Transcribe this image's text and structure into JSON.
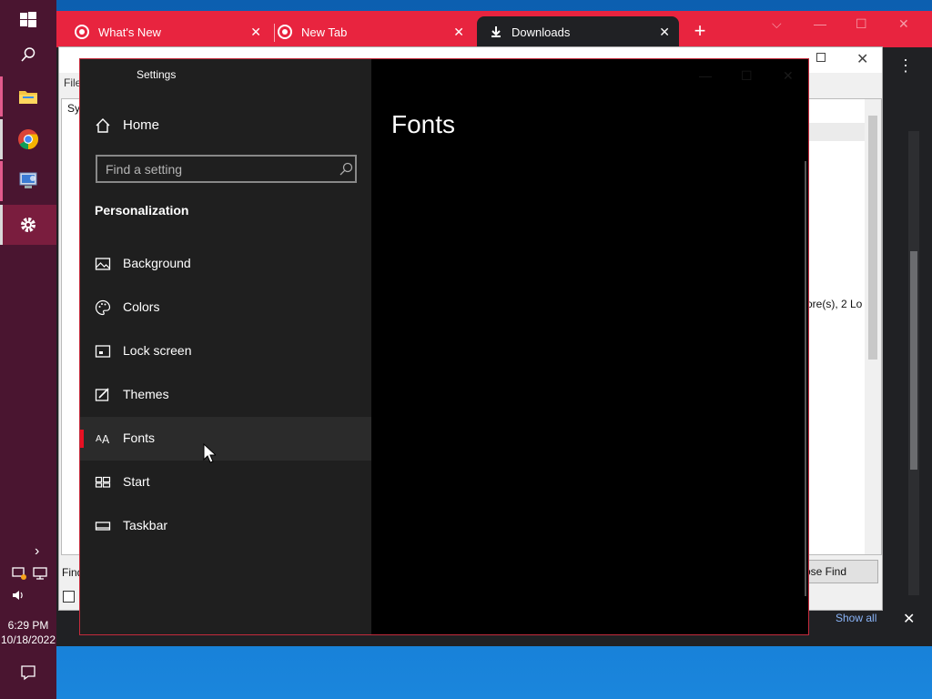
{
  "chrome": {
    "tabs": [
      {
        "label": "What's New",
        "close": "✕"
      },
      {
        "label": "New Tab",
        "close": "✕"
      },
      {
        "label": "Downloads",
        "close": "✕"
      }
    ],
    "new_tab": "+",
    "menu_icon": "⋮",
    "download_bar": {
      "show_all": "Show all",
      "close": "✕"
    },
    "window_controls": {
      "minimize": "—",
      "maximize": "☐",
      "close": "✕"
    }
  },
  "sysinfo": {
    "menu_file": "File",
    "tree_label": "Sy",
    "list_fragment": "ore(s), 2 Lo",
    "find_label": "Find",
    "close_find_label": "ose Find",
    "close": "✕"
  },
  "settings": {
    "window_title": "Settings",
    "home_label": "Home",
    "search_placeholder": "Find a setting",
    "section_heading": "Personalization",
    "page_heading": "Fonts",
    "nav_items": [
      {
        "label": "Background",
        "icon": "picture-icon"
      },
      {
        "label": "Colors",
        "icon": "palette-icon"
      },
      {
        "label": "Lock screen",
        "icon": "lock-screen-icon"
      },
      {
        "label": "Themes",
        "icon": "themes-icon"
      },
      {
        "label": "Fonts",
        "icon": "fonts-icon",
        "selected": true
      },
      {
        "label": "Start",
        "icon": "start-icon"
      },
      {
        "label": "Taskbar",
        "icon": "taskbar-icon"
      }
    ],
    "accent_color": "#e81123"
  },
  "taskbar": {
    "time": "6:29 PM",
    "date": "10/18/2022",
    "expand_icon": "›",
    "apps": [
      "windows-start-icon",
      "search-icon",
      "file-explorer-icon",
      "chrome-icon",
      "system-info-icon",
      "settings-icon"
    ]
  },
  "colors": {
    "taskbar_bg": "#4a1530",
    "chrome_tab_bar": "#e8243f",
    "settings_nav_bg": "#1f1f1f",
    "settings_border": "#c42b3c"
  }
}
